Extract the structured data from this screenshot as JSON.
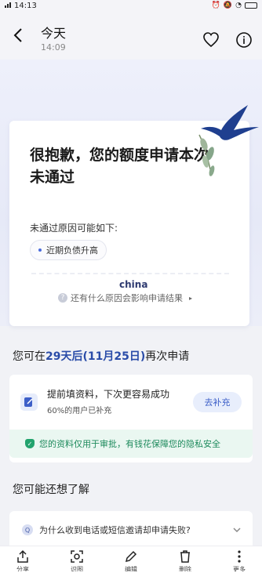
{
  "status_bar": {
    "time": "14:13"
  },
  "header": {
    "title": "今天",
    "subtitle": "14:09"
  },
  "hero": {
    "title": "很抱歉，您的额度申请本次未通过",
    "reason_heading": "未通过原因可能如下:",
    "reasons": [
      "近期负债升高"
    ],
    "watermark": "china",
    "more_link": "还有什么原因会影响申请结果"
  },
  "reapply": {
    "prefix": "您可在",
    "days": "29天后",
    "date": "(11月25日)",
    "suffix": "再次申请"
  },
  "tip_card": {
    "title": "提前填资料，下次更容易成功",
    "subtitle": "60%的用户已补充",
    "button": "去补充",
    "privacy": "您的资料仅用于审批，有钱花保障您的隐私安全"
  },
  "also": {
    "title": "您可能还想了解",
    "questions": [
      "为什么收到电话或短信邀请却申请失败?"
    ]
  },
  "bottom_bar": {
    "items": [
      {
        "icon": "share-icon",
        "label": "分享"
      },
      {
        "icon": "scan-icon",
        "label": "识图"
      },
      {
        "icon": "edit-icon",
        "label": "编辑"
      },
      {
        "icon": "delete-icon",
        "label": "删除"
      },
      {
        "icon": "more-icon",
        "label": "更多"
      }
    ]
  },
  "colors": {
    "accent": "#2a4ca8",
    "privacy_green": "#1d8a5c",
    "button_bg": "#e8eefc"
  }
}
